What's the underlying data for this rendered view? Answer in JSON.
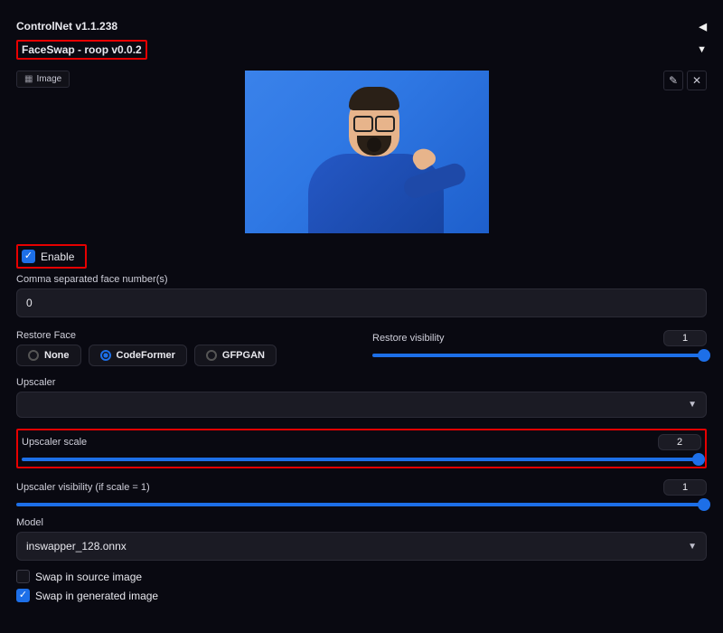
{
  "panels": {
    "controlnet": {
      "title": "ControlNet v1.1.238"
    },
    "faceswap": {
      "title": "FaceSwap - roop v0.0.2"
    }
  },
  "imageBtn": {
    "label": "Image"
  },
  "enable": {
    "label": "Enable",
    "checked": true
  },
  "faceNumbers": {
    "label": "Comma separated face number(s)",
    "value": "0"
  },
  "restoreFace": {
    "label": "Restore Face",
    "options": {
      "none": "None",
      "codeformer": "CodeFormer",
      "gfpgan": "GFPGAN"
    },
    "selected": "codeformer"
  },
  "restoreVisibility": {
    "label": "Restore visibility",
    "value": "1"
  },
  "upscaler": {
    "label": "Upscaler",
    "value": ""
  },
  "upscalerScale": {
    "label": "Upscaler scale",
    "value": "2"
  },
  "upscalerVisibility": {
    "label": "Upscaler visibility (if scale = 1)",
    "value": "1"
  },
  "model": {
    "label": "Model",
    "value": "inswapper_128.onnx"
  },
  "swapSource": {
    "label": "Swap in source image",
    "checked": false
  },
  "swapGenerated": {
    "label": "Swap in generated image",
    "checked": true
  }
}
